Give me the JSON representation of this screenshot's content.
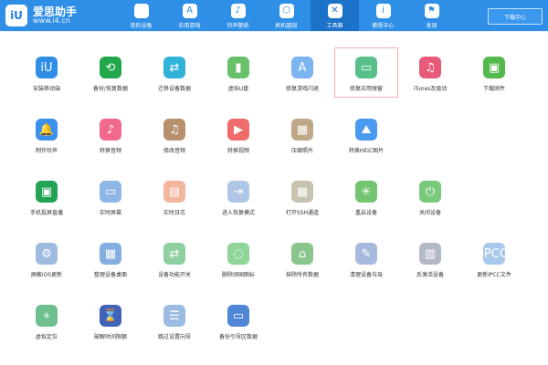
{
  "brand": {
    "title": "爱思助手",
    "url": "www.i4.cn",
    "badge": "iU"
  },
  "nav": {
    "items": [
      {
        "label": "我的设备",
        "icon": ""
      },
      {
        "label": "应用游戏",
        "icon": "A"
      },
      {
        "label": "铃声壁纸",
        "icon": "♪"
      },
      {
        "label": "刷机越狱",
        "icon": "⬡"
      },
      {
        "label": "工具箱",
        "icon": "✕"
      },
      {
        "label": "教程中心",
        "icon": "i"
      },
      {
        "label": "发现",
        "icon": "⚑"
      }
    ],
    "active_index": 4,
    "download_label": "下载中心"
  },
  "tools": {
    "rows": [
      [
        {
          "label": "安装移动端",
          "icon": "iU",
          "color": "#2f8fe6"
        },
        {
          "label": "备份/恢复数据",
          "icon": "⟲",
          "color": "#22a84a"
        },
        {
          "label": "迁移设备数据",
          "icon": "⇄",
          "color": "#31b3d9"
        },
        {
          "label": "虚拟U盘",
          "icon": "▮",
          "color": "#69c06b"
        },
        {
          "label": "修复游戏闪退",
          "icon": "A",
          "color": "#7bb4f0"
        },
        {
          "label": "修复应用弹窗",
          "icon": "▭",
          "color": "#59c08a"
        },
        {
          "label": "iTunes及驱动",
          "icon": "♫",
          "color": "#e85a7a"
        },
        {
          "label": "下载固件",
          "icon": "▣",
          "color": "#55b84f"
        }
      ],
      [
        {
          "label": "制作铃声",
          "icon": "🔔",
          "color": "#3a90ec"
        },
        {
          "label": "转换音频",
          "icon": "♪",
          "color": "#f16a8e"
        },
        {
          "label": "修改音频",
          "icon": "♫",
          "color": "#b7906e"
        },
        {
          "label": "转换视频",
          "icon": "▶",
          "color": "#f06b6b"
        },
        {
          "label": "压缩照片",
          "icon": "▦",
          "color": "#bfa887"
        },
        {
          "label": "转换HEIC图片",
          "icon": "⛰",
          "color": "#4a9af0"
        }
      ],
      [
        {
          "label": "手机投屏直播",
          "icon": "▣",
          "color": "#23a357"
        },
        {
          "label": "实时屏幕",
          "icon": "▭",
          "color": "#8eb7e6"
        },
        {
          "label": "实时日志",
          "icon": "▤",
          "color": "#f4b59e"
        },
        {
          "label": "进入恢复模式",
          "icon": "⇥",
          "color": "#b0c6e6"
        },
        {
          "label": "打开SSH通道",
          "icon": "▦",
          "color": "#c8c2b0"
        },
        {
          "label": "重启设备",
          "icon": "✳",
          "color": "#73c56f"
        },
        {
          "label": "关闭设备",
          "icon": "⏻",
          "color": "#78c97b"
        }
      ],
      [
        {
          "label": "屏蔽iOS更新",
          "icon": "⚙",
          "color": "#9fbbe0"
        },
        {
          "label": "整理设备桌面",
          "icon": "▦",
          "color": "#85aee0"
        },
        {
          "label": "设备功能开关",
          "icon": "⇄",
          "color": "#8fcfa0"
        },
        {
          "label": "删除顽固图标",
          "icon": "◌",
          "color": "#8fd59a"
        },
        {
          "label": "抹除所有数据",
          "icon": "⌂",
          "color": "#8bc58e"
        },
        {
          "label": "清理设备垃圾",
          "icon": "✎",
          "color": "#a7b9dd"
        },
        {
          "label": "反激活设备",
          "icon": "▥",
          "color": "#b4b9c8"
        },
        {
          "label": "更新IPCC文件",
          "icon": "IPCC",
          "color": "#a8c9ea"
        }
      ],
      [
        {
          "label": "虚拟定位",
          "icon": "⌖",
          "color": "#6fc08e"
        },
        {
          "label": "破解时间限额",
          "icon": "⌛",
          "color": "#3e63b8"
        },
        {
          "label": "跳过设置向导",
          "icon": "☰",
          "color": "#9bbbe2"
        },
        {
          "label": "备份引导区数据",
          "icon": "▭",
          "color": "#4f86d6"
        }
      ]
    ],
    "selected": {
      "row": 0,
      "col": 5
    }
  }
}
